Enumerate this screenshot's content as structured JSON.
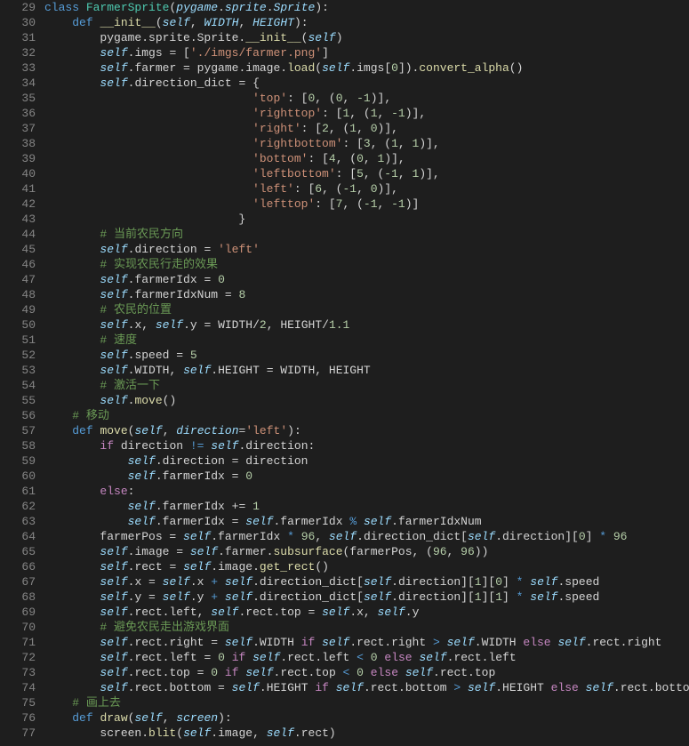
{
  "first_line": 29,
  "lines": [
    "<span class='kw'>class</span> <span class='cls'>FarmerSprite</span>(<span class='self'>pygame</span>.<span class='self'>sprite</span>.<span class='self'>Sprite</span>):",
    "    <span class='kw'>def</span> <span class='fn'>__init__</span>(<span class='self'>self</span>, <span class='self'>WIDTH</span>, <span class='self'>HEIGHT</span>):",
    "        pygame.sprite.Sprite.<span class='fn'>__init__</span>(<span class='self'>self</span>)",
    "        <span class='self'>self</span>.imgs = [<span class='str'>'./imgs/farmer.png'</span>]",
    "        <span class='self'>self</span>.farmer = pygame.image.<span class='fn'>load</span>(<span class='self'>self</span>.imgs[<span class='num'>0</span>]).<span class='fn'>convert_alpha</span>()",
    "        <span class='self'>self</span>.direction_dict = {",
    "                              <span class='str'>'top'</span>: [<span class='num'>0</span>, (<span class='num'>0</span>, <span class='num'>-1</span>)],",
    "                              <span class='str'>'righttop'</span>: [<span class='num'>1</span>, (<span class='num'>1</span>, <span class='num'>-1</span>)],",
    "                              <span class='str'>'right'</span>: [<span class='num'>2</span>, (<span class='num'>1</span>, <span class='num'>0</span>)],",
    "                              <span class='str'>'rightbottom'</span>: [<span class='num'>3</span>, (<span class='num'>1</span>, <span class='num'>1</span>)],",
    "                              <span class='str'>'bottom'</span>: [<span class='num'>4</span>, (<span class='num'>0</span>, <span class='num'>1</span>)],",
    "                              <span class='str'>'leftbottom'</span>: [<span class='num'>5</span>, (<span class='num'>-1</span>, <span class='num'>1</span>)],",
    "                              <span class='str'>'left'</span>: [<span class='num'>6</span>, (<span class='num'>-1</span>, <span class='num'>0</span>)],",
    "                              <span class='str'>'lefttop'</span>: [<span class='num'>7</span>, (<span class='num'>-1</span>, <span class='num'>-1</span>)]",
    "                            }",
    "        <span class='cmt'># 当前农民方向</span>",
    "        <span class='self'>self</span>.direction = <span class='str'>'left'</span>",
    "        <span class='cmt'># 实现农民行走的效果</span>",
    "        <span class='self'>self</span>.farmerIdx = <span class='num'>0</span>",
    "        <span class='self'>self</span>.farmerIdxNum = <span class='num'>8</span>",
    "        <span class='cmt'># 农民的位置</span>",
    "        <span class='self'>self</span>.x, <span class='self'>self</span>.y = WIDTH/<span class='num'>2</span>, HEIGHT/<span class='num'>1.1</span>",
    "        <span class='cmt'># 速度</span>",
    "        <span class='self'>self</span>.speed = <span class='num'>5</span>",
    "        <span class='self'>self</span>.WIDTH, <span class='self'>self</span>.HEIGHT = WIDTH, HEIGHT",
    "        <span class='cmt'># 激活一下</span>",
    "        <span class='self'>self</span>.<span class='fn'>move</span>()",
    "    <span class='cmt'># 移动</span>",
    "    <span class='kw'>def</span> <span class='fn'>move</span>(<span class='self'>self</span>, <span class='self'>direction</span>=<span class='str'>'left'</span>):",
    "        <span class='pink'>if</span> direction <span class='kw'>!=</span> <span class='self'>self</span>.direction:",
    "            <span class='self'>self</span>.direction = direction",
    "            <span class='self'>self</span>.farmerIdx = <span class='num'>0</span>",
    "        <span class='pink'>else</span>:",
    "            <span class='self'>self</span>.farmerIdx += <span class='num'>1</span>",
    "            <span class='self'>self</span>.farmerIdx = <span class='self'>self</span>.farmerIdx <span class='kw'>%</span> <span class='self'>self</span>.farmerIdxNum",
    "        farmerPos = <span class='self'>self</span>.farmerIdx <span class='kw'>*</span> <span class='num'>96</span>, <span class='self'>self</span>.direction_dict[<span class='self'>self</span>.direction][<span class='num'>0</span>] <span class='kw'>*</span> <span class='num'>96</span>",
    "        <span class='self'>self</span>.image = <span class='self'>self</span>.farmer.<span class='fn'>subsurface</span>(farmerPos, (<span class='num'>96</span>, <span class='num'>96</span>))",
    "        <span class='self'>self</span>.rect = <span class='self'>self</span>.image.<span class='fn'>get_rect</span>()",
    "        <span class='self'>self</span>.x = <span class='self'>self</span>.x <span class='kw'>+</span> <span class='self'>self</span>.direction_dict[<span class='self'>self</span>.direction][<span class='num'>1</span>][<span class='num'>0</span>] <span class='kw'>*</span> <span class='self'>self</span>.speed",
    "        <span class='self'>self</span>.y = <span class='self'>self</span>.y <span class='kw'>+</span> <span class='self'>self</span>.direction_dict[<span class='self'>self</span>.direction][<span class='num'>1</span>][<span class='num'>1</span>] <span class='kw'>*</span> <span class='self'>self</span>.speed",
    "        <span class='self'>self</span>.rect.left, <span class='self'>self</span>.rect.top = <span class='self'>self</span>.x, <span class='self'>self</span>.y",
    "        <span class='cmt'># 避免农民走出游戏界面</span>",
    "        <span class='self'>self</span>.rect.right = <span class='self'>self</span>.WIDTH <span class='pink'>if</span> <span class='self'>self</span>.rect.right <span class='kw'>&gt;</span> <span class='self'>self</span>.WIDTH <span class='pink'>else</span> <span class='self'>self</span>.rect.right",
    "        <span class='self'>self</span>.rect.left = <span class='num'>0</span> <span class='pink'>if</span> <span class='self'>self</span>.rect.left <span class='kw'>&lt;</span> <span class='num'>0</span> <span class='pink'>else</span> <span class='self'>self</span>.rect.left",
    "        <span class='self'>self</span>.rect.top = <span class='num'>0</span> <span class='pink'>if</span> <span class='self'>self</span>.rect.top <span class='kw'>&lt;</span> <span class='num'>0</span> <span class='pink'>else</span> <span class='self'>self</span>.rect.top",
    "        <span class='self'>self</span>.rect.bottom = <span class='self'>self</span>.HEIGHT <span class='pink'>if</span> <span class='self'>self</span>.rect.bottom <span class='kw'>&gt;</span> <span class='self'>self</span>.HEIGHT <span class='pink'>else</span> <span class='self'>self</span>.rect.bottom",
    "    <span class='cmt'># 画上去</span>",
    "    <span class='kw'>def</span> <span class='fn'>draw</span>(<span class='self'>self</span>, <span class='self'>screen</span>):",
    "        screen.<span class='fn'>blit</span>(<span class='self'>self</span>.image, <span class='self'>self</span>.rect)"
  ]
}
